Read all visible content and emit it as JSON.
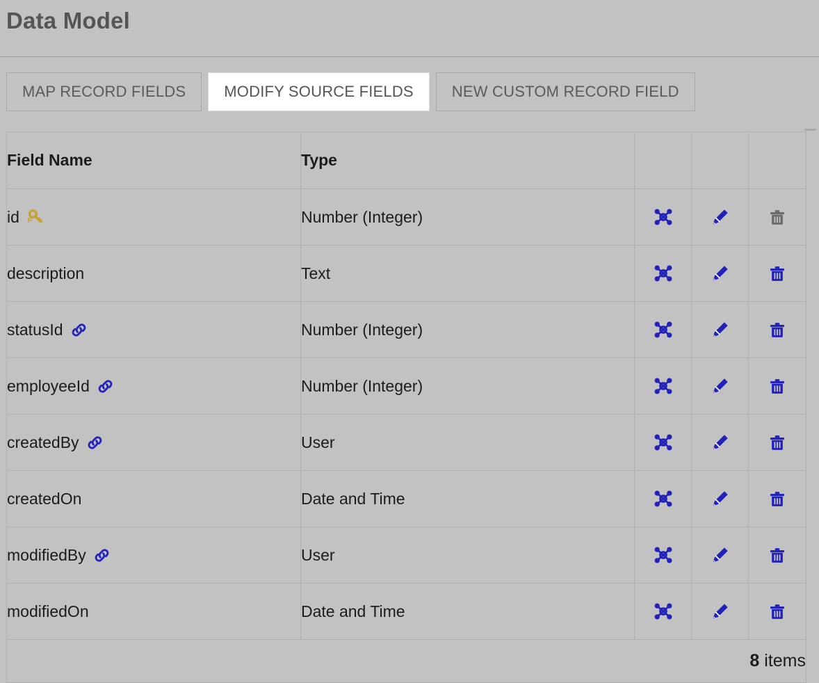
{
  "header": {
    "title": "Data Model"
  },
  "tabs": [
    {
      "label": "MAP RECORD FIELDS",
      "active": false,
      "name": "tab-map-record-fields"
    },
    {
      "label": "MODIFY SOURCE FIELDS",
      "active": true,
      "name": "tab-modify-source-fields"
    },
    {
      "label": "NEW CUSTOM RECORD FIELD",
      "active": false,
      "name": "tab-new-custom-record-field"
    }
  ],
  "table": {
    "columns": [
      "Field Name",
      "Type",
      "",
      "",
      ""
    ],
    "rows": [
      {
        "field": "id",
        "type": "Number (Integer)",
        "badge": "primary-key",
        "delete_enabled": false
      },
      {
        "field": "description",
        "type": "Text",
        "badge": "none",
        "delete_enabled": true
      },
      {
        "field": "statusId",
        "type": "Number (Integer)",
        "badge": "link",
        "delete_enabled": true
      },
      {
        "field": "employeeId",
        "type": "Number (Integer)",
        "badge": "link",
        "delete_enabled": true
      },
      {
        "field": "createdBy",
        "type": "User",
        "badge": "link",
        "delete_enabled": true
      },
      {
        "field": "createdOn",
        "type": "Date and Time",
        "badge": "none",
        "delete_enabled": true
      },
      {
        "field": "modifiedBy",
        "type": "User",
        "badge": "link",
        "delete_enabled": true
      },
      {
        "field": "modifiedOn",
        "type": "Date and Time",
        "badge": "none",
        "delete_enabled": true
      }
    ],
    "footer": {
      "count": "8",
      "count_suffix": " items"
    }
  },
  "icons": {
    "primary_key": "primary-key-icon",
    "link": "link-icon",
    "relationship": "relationship-hub-icon",
    "edit": "edit-pencil-icon",
    "delete": "delete-trash-icon"
  },
  "colors": {
    "page_background": "#c2c2c2",
    "title_text": "#555555",
    "cell_text": "#1c1c1c",
    "grid_border": "#b0b0b0",
    "tab_border": "#a8a8a8",
    "active_tab_background": "#ffffff",
    "key_gold": "#c8a02e",
    "action_blue": "#2222bb",
    "disabled_grey": "#6b6b6b"
  }
}
